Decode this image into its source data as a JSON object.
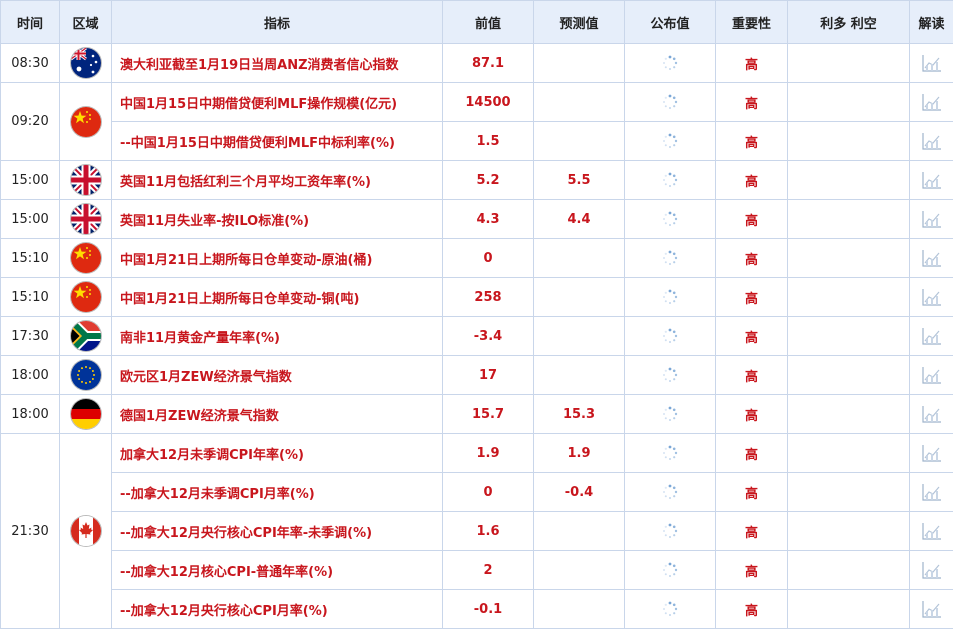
{
  "headers": {
    "time": "时间",
    "region": "区域",
    "indicator": "指标",
    "previous": "前值",
    "forecast": "预测值",
    "actual": "公布值",
    "importance": "重要性",
    "bull_bear": "利多 利空",
    "analysis": "解读"
  },
  "colors": {
    "header_bg": "#e6eefa",
    "border": "#c9d6ea",
    "accent_red": "#c8161d"
  },
  "icons": {
    "loading": "loading-spinner-icon",
    "analysis": "chart-analysis-icon"
  },
  "groups": [
    {
      "time": "08:30",
      "flag": "australia",
      "rows": [
        {
          "indicator": "澳大利亚截至1月19日当周ANZ消费者信心指数",
          "previous": "87.1",
          "forecast": "",
          "importance": "高"
        }
      ]
    },
    {
      "time": "09:20",
      "flag": "china",
      "rows": [
        {
          "indicator": "中国1月15日中期借贷便利MLF操作规模(亿元)",
          "previous": "14500",
          "forecast": "",
          "importance": "高"
        },
        {
          "indicator": "--中国1月15日中期借贷便利MLF中标利率(%)",
          "previous": "1.5",
          "forecast": "",
          "importance": "高"
        }
      ]
    },
    {
      "time": "15:00",
      "flag": "uk",
      "rows": [
        {
          "indicator": "英国11月包括红利三个月平均工资年率(%)",
          "previous": "5.2",
          "forecast": "5.5",
          "importance": "高"
        }
      ]
    },
    {
      "time": "15:00",
      "flag": "uk",
      "rows": [
        {
          "indicator": "英国11月失业率-按ILO标准(%)",
          "previous": "4.3",
          "forecast": "4.4",
          "importance": "高"
        }
      ]
    },
    {
      "time": "15:10",
      "flag": "china",
      "rows": [
        {
          "indicator": "中国1月21日上期所每日仓单变动-原油(桶)",
          "previous": "0",
          "forecast": "",
          "importance": "高"
        }
      ]
    },
    {
      "time": "15:10",
      "flag": "china",
      "rows": [
        {
          "indicator": "中国1月21日上期所每日仓单变动-铜(吨)",
          "previous": "258",
          "forecast": "",
          "importance": "高"
        }
      ]
    },
    {
      "time": "17:30",
      "flag": "south-africa",
      "rows": [
        {
          "indicator": "南非11月黄金产量年率(%)",
          "previous": "-3.4",
          "forecast": "",
          "importance": "高"
        }
      ]
    },
    {
      "time": "18:00",
      "flag": "eu",
      "rows": [
        {
          "indicator": "欧元区1月ZEW经济景气指数",
          "previous": "17",
          "forecast": "",
          "importance": "高"
        }
      ]
    },
    {
      "time": "18:00",
      "flag": "germany",
      "rows": [
        {
          "indicator": "德国1月ZEW经济景气指数",
          "previous": "15.7",
          "forecast": "15.3",
          "importance": "高"
        }
      ]
    },
    {
      "time": "21:30",
      "flag": "canada",
      "rows": [
        {
          "indicator": "加拿大12月未季调CPI年率(%)",
          "previous": "1.9",
          "forecast": "1.9",
          "importance": "高"
        },
        {
          "indicator": "--加拿大12月未季调CPI月率(%)",
          "previous": "0",
          "forecast": "-0.4",
          "importance": "高"
        },
        {
          "indicator": "--加拿大12月央行核心CPI年率-未季调(%)",
          "previous": "1.6",
          "forecast": "",
          "importance": "高"
        },
        {
          "indicator": "--加拿大12月核心CPI-普通年率(%)",
          "previous": "2",
          "forecast": "",
          "importance": "高"
        },
        {
          "indicator": "--加拿大12月央行核心CPI月率(%)",
          "previous": "-0.1",
          "forecast": "",
          "importance": "高"
        }
      ]
    }
  ]
}
